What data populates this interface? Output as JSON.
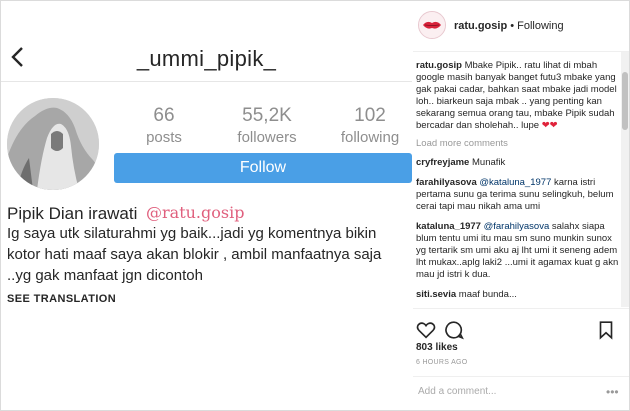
{
  "profile": {
    "username_title": "_ummi_pipik_",
    "stats": [
      {
        "value": "66",
        "label": "posts"
      },
      {
        "value": "55,2K",
        "label": "followers"
      },
      {
        "value": "102",
        "label": "following"
      }
    ],
    "follow_label": "Follow",
    "display_name": "Pipik Dian irawati",
    "watermark": "@ratu.gosip",
    "bio": "Ig saya utk silaturahmi yg baik...jadi yg komentnya bikin kotor hati maaf saya akan blokir , ambil manfaatnya saja ..yg gak manfaat jgn dicontoh",
    "see_translation": "SEE TRANSLATION"
  },
  "post": {
    "account": "ratu.gosip",
    "follow_status": "• Following",
    "caption_user": "ratu.gosip",
    "caption": "Mbake Pipik.. ratu lihat di mbah google masih banyak banget futu3 mbake yang gak pakai cadar, bahkan saat mbake jadi model loh.. biarkeun saja mbak .. yang penting kan sekarang semua orang tau, mbake Pipik sudah bercadar dan sholehah.. lupe",
    "caption_hearts": "❤❤",
    "load_more": "Load more comments",
    "comments": [
      {
        "user": "cryfreyjame",
        "text": "Munafik",
        "mention": ""
      },
      {
        "user": "farahilyasova",
        "mention": "@kataluna_1977",
        "text": "karna istri pertama sunu ga terima sunu selingkuh, belum cerai tapi mau nikah ama umi"
      },
      {
        "user": "kataluna_1977",
        "mention": "@farahilyasova",
        "text": "salahx siapa blum tentu umi itu mau sm suno munkin sunox yg tertarik sm umi aku aj lht umi it seneng adem lht mukax..aplg laki2 ...umi it agamax kuat g akn mau jd istri k dua."
      },
      {
        "user": "siti.sevia",
        "mention": "",
        "text": "maaf bunda..."
      }
    ],
    "likes": "803 likes",
    "time": "6 HOURS AGO",
    "add_comment_placeholder": "Add a comment...",
    "more_glyph": "•••"
  }
}
